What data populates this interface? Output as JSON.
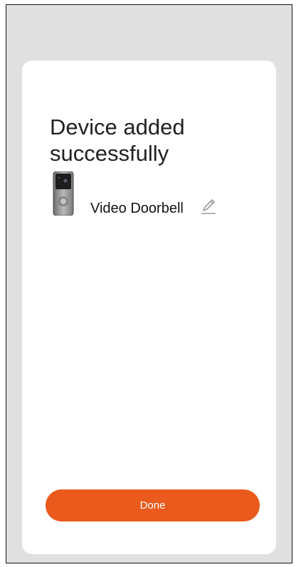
{
  "dialog": {
    "title": "Device added successfully"
  },
  "device": {
    "name": "Video Doorbell",
    "image_icon": "video-doorbell-icon",
    "edit_icon": "pencil-edit-icon"
  },
  "actions": {
    "done_label": "Done"
  },
  "colors": {
    "accent": "#ea5a1c",
    "backdrop": "#e0e0e0",
    "card": "#ffffff",
    "text": "#222222",
    "icon": "#9a9a9a"
  }
}
